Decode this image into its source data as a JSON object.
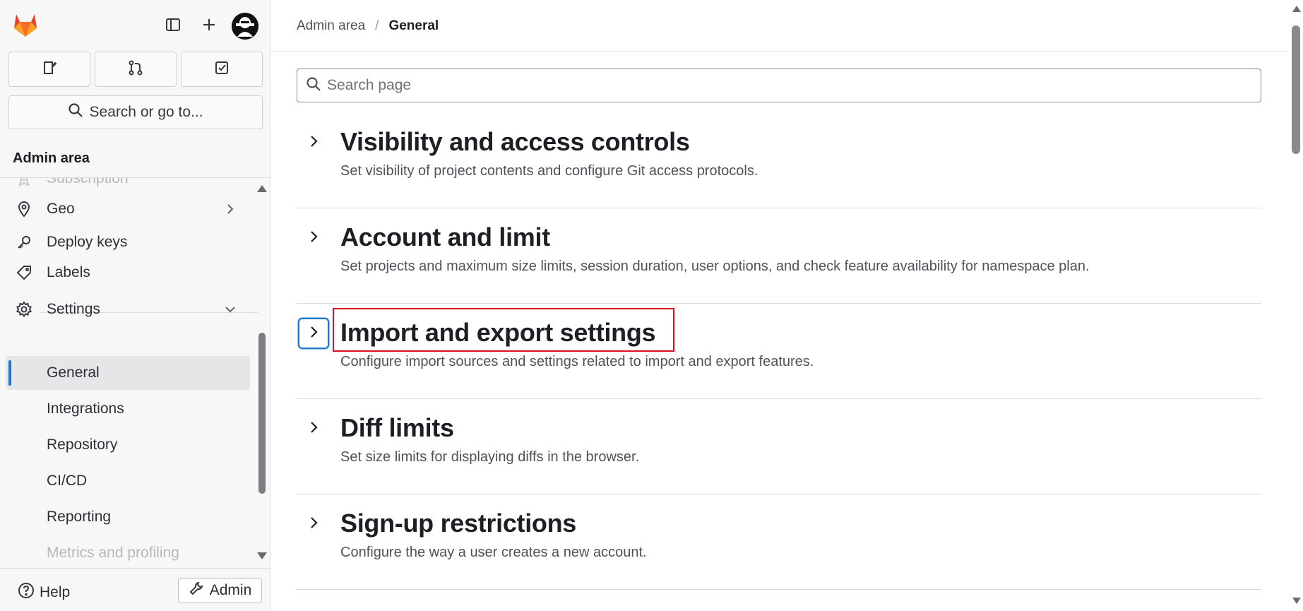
{
  "topbar": {
    "logo_icon": "gitlab-tanuki-icon",
    "toggle_sidebar_icon": "sidebar-toggle-icon",
    "new_icon": "plus-icon",
    "avatar_icon": "user-avatar"
  },
  "quick_actions": [
    {
      "icon": "issues-icon"
    },
    {
      "icon": "merge-request-icon"
    },
    {
      "icon": "todo-checkbox-icon"
    }
  ],
  "search_go": {
    "label": "Search or go to..."
  },
  "sidebar": {
    "heading": "Admin area",
    "items": [
      {
        "label": "Subscription",
        "icon": "subscription-icon",
        "state": "faded"
      },
      {
        "label": "Geo",
        "icon": "location-pin-icon",
        "has_chevron": "right"
      },
      {
        "label": "Deploy keys",
        "icon": "key-icon"
      },
      {
        "label": "Labels",
        "icon": "label-tag-icon"
      },
      {
        "label": "Settings",
        "icon": "settings-gear-icon",
        "has_chevron": "down"
      },
      {
        "label": "General",
        "active": true
      },
      {
        "label": "Integrations"
      },
      {
        "label": "Repository"
      },
      {
        "label": "CI/CD"
      },
      {
        "label": "Reporting"
      },
      {
        "label": "Metrics and profiling",
        "state": "faded"
      }
    ]
  },
  "footer": {
    "help_label": "Help",
    "admin_label": "Admin"
  },
  "breadcrumb": {
    "root": "Admin area",
    "separator": "/",
    "current": "General"
  },
  "search_page": {
    "placeholder": "Search page",
    "value": ""
  },
  "sections": [
    {
      "title": "Visibility and access controls",
      "description": "Set visibility of project contents and configure Git access protocols."
    },
    {
      "title": "Account and limit",
      "description": "Set projects and maximum size limits, session duration, user options, and check feature availability for namespace plan."
    },
    {
      "title": "Import and export settings",
      "description": "Configure import sources and settings related to import and export features.",
      "highlighted": true
    },
    {
      "title": "Diff limits",
      "description": "Set size limits for displaying diffs in the browser."
    },
    {
      "title": "Sign-up restrictions",
      "description": "Configure the way a user creates a new account."
    }
  ],
  "colors": {
    "accent_blue": "#1f75cb",
    "highlight_red": "#e0101e",
    "sidebar_bg": "#f7f7f8"
  }
}
